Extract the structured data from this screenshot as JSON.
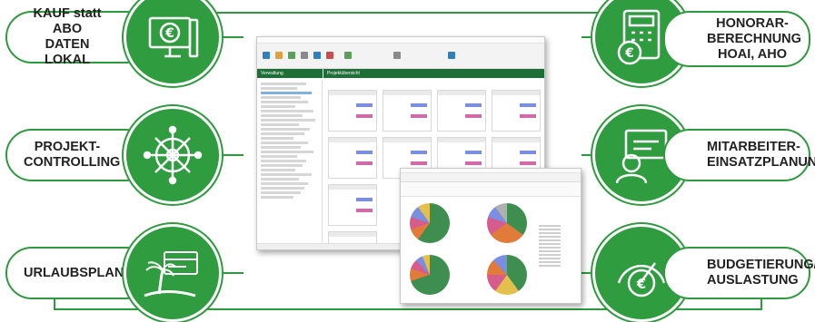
{
  "features_left": [
    {
      "label": "KAUF statt ABO\nDATEN LOKAL",
      "icon": "computer-euro-icon"
    },
    {
      "label": "PROJEKT-\nCONTROLLING",
      "icon": "ship-wheel-icon"
    },
    {
      "label": "URLAUBSPLAN",
      "icon": "palm-island-icon"
    }
  ],
  "features_right": [
    {
      "label": "HONORAR-\nBERECHNUNG\nHOAI, AHO",
      "icon": "calculator-euro-icon"
    },
    {
      "label": "MITARBEITER-\nEINSATZPLANUNG",
      "icon": "employee-card-icon"
    },
    {
      "label": "BUDGETIERUNG/\nAUSLASTUNG",
      "icon": "gauge-euro-icon"
    }
  ],
  "colors": {
    "accent": "#2e9a3e",
    "circle": "#2f9c3f",
    "app_header": "#1f6e37"
  },
  "screenshot_main": {
    "left_panel_title": "Verwaltung",
    "right_panel_title": "Projektübersicht"
  }
}
